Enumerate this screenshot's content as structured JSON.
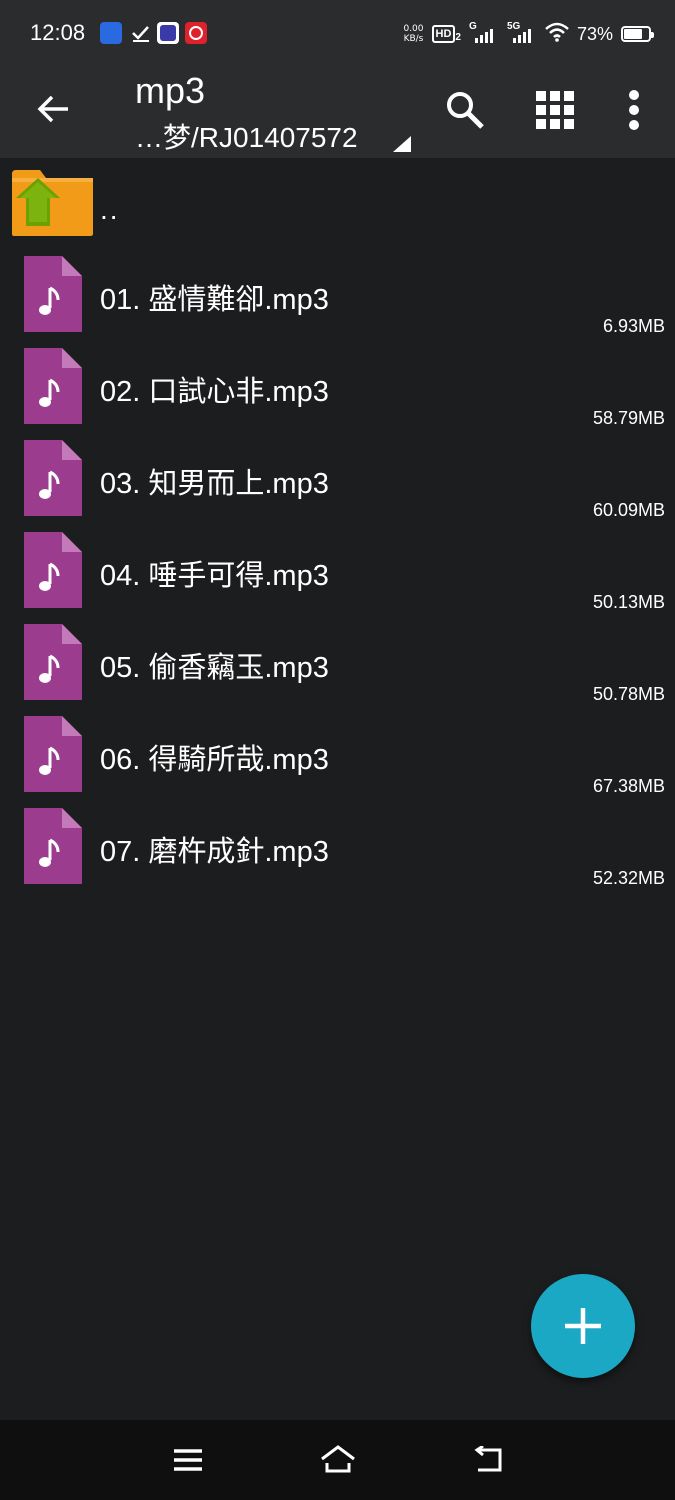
{
  "status_bar": {
    "time": "12:08",
    "net_speed_value": "0.00",
    "net_speed_unit": "KB/s",
    "hd_label": "HD",
    "hd_sub": "2",
    "sim1_label": "G",
    "sim2_label": "5G",
    "battery_percent": "73%",
    "battery_level": 0.73
  },
  "toolbar": {
    "title": "mp3",
    "path": "…梦/RJ01407572",
    "back_icon": "arrow-left-icon",
    "search_icon": "search-icon",
    "view_icon": "grid-view-icon",
    "more_icon": "more-vertical-icon"
  },
  "parent_dir": {
    "label": "..",
    "icon": "folder-up-icon"
  },
  "files": [
    {
      "name": "01. 盛情難卻.mp3",
      "size": "6.93MB"
    },
    {
      "name": "02. 口試心非.mp3",
      "size": "58.79MB"
    },
    {
      "name": "03. 知男而上.mp3",
      "size": "60.09MB"
    },
    {
      "name": "04. 唾手可得.mp3",
      "size": "50.13MB"
    },
    {
      "name": "05. 偷香竊玉.mp3",
      "size": "50.78MB"
    },
    {
      "name": "06. 得騎所哉.mp3",
      "size": "67.38MB"
    },
    {
      "name": "07. 磨杵成針.mp3",
      "size": "52.32MB"
    }
  ],
  "fab": {
    "icon": "plus-icon"
  },
  "nav": {
    "menu_icon": "menu-icon",
    "home_icon": "home-icon",
    "back_icon": "back-icon"
  },
  "colors": {
    "background": "#1c1d1f",
    "toolbar": "#2b2c2e",
    "audio_file": "#9c3c8f",
    "folder": "#f29b18",
    "fab": "#1aa8c4"
  }
}
